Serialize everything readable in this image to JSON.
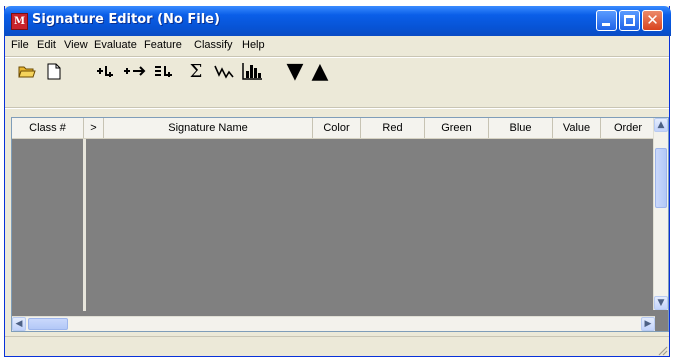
{
  "window": {
    "title": "Signature Editor (No File)",
    "app_icon": "signature-editor-app-icon",
    "controls": [
      "minimize-icon",
      "maximize-icon",
      "close-icon"
    ],
    "close_glyph": "✕"
  },
  "menu": {
    "items": [
      "File",
      "Edit",
      "View",
      "Evaluate",
      "Feature",
      "Classify",
      "Help"
    ]
  },
  "toolbar": {
    "tools": [
      {
        "name": "open-folder-icon"
      },
      {
        "name": "new-document-icon"
      },
      {
        "name": "add-signature-icon"
      },
      {
        "name": "replace-signature-icon"
      },
      {
        "name": "merge-signatures-icon"
      },
      {
        "name": "sigma-statistics-icon",
        "glyph": "Σ"
      },
      {
        "name": "mean-plot-icon"
      },
      {
        "name": "histogram-icon"
      },
      {
        "name": "move-down-triangle-icon",
        "glyph": "▼"
      },
      {
        "name": "move-up-triangle-icon",
        "glyph": "▲"
      }
    ]
  },
  "table": {
    "columns": [
      "Class #",
      ">",
      "Signature Name",
      "Color",
      "Red",
      "Green",
      "Blue",
      "Value",
      "Order"
    ],
    "rows": []
  },
  "scrollbars": {
    "up": "▲",
    "down": "▼",
    "left": "◀",
    "right": "▶"
  }
}
